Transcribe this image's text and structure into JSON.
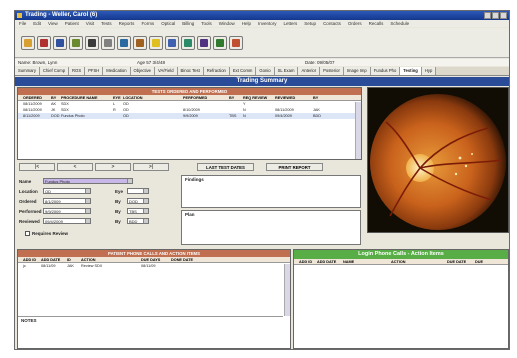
{
  "window": {
    "title": "Trading - Weller, Carol (6)"
  },
  "menu": [
    "File",
    "Edit",
    "View",
    "Patient",
    "Visit",
    "Tests",
    "Reports",
    "Forms",
    "Optical",
    "Billing",
    "Tools",
    "Window",
    "Help",
    "Inventory",
    "Letters",
    "Setup",
    "Contacts",
    "Orders",
    "Recalls",
    "Schedule"
  ],
  "toolbar": [
    "folder",
    "print",
    "person",
    "card",
    "binoculars",
    "glasses",
    "eye",
    "camera",
    "alert",
    "document",
    "grid",
    "network",
    "chart",
    "help"
  ],
  "patient": {
    "name": "Name: Brown, Lynn",
    "age": "Age 57  3/4/48",
    "date": "Date: 09/05/07"
  },
  "tabs": [
    "Summary",
    "Chief Comp",
    "ROS",
    "PFSH",
    "Medication",
    "Objective",
    "VA/Field",
    "Binoc Test",
    "Refraction",
    "Ext Comm",
    "Gonio",
    "SL Exam",
    "Anterior",
    "Posterior",
    "Image Imp",
    "Fundus Pho",
    "Testing",
    "Hyp"
  ],
  "active_tab": "Testing",
  "banner": "Trading Summary",
  "results": {
    "header": "TESTS ORDERED AND PERFORMED",
    "columns": [
      "ORDERED",
      "BY",
      "PROCEDURE NAME",
      "EYE",
      "LOCATION",
      "PERFORMED",
      "BY",
      "REQ REVIEW",
      "REVIEWED",
      "BY"
    ],
    "rows": [
      [
        "08/11/2009",
        "AK",
        "SDX",
        "L",
        "OD",
        "",
        "",
        "Y",
        "",
        ""
      ],
      [
        "08/11/2009",
        "JK",
        "SDX",
        "R",
        "OD",
        "8/10/2009",
        "",
        "N",
        "08/11/2009",
        "JAK"
      ],
      [
        "8/11/2009",
        "DOD",
        "Fundus Photo",
        "",
        "OD",
        "9/9/2009",
        "TBS",
        "N",
        "09/4/2009",
        "BDD"
      ]
    ]
  },
  "nav": {
    "first": "|<",
    "prev": "<",
    "next": ">",
    "last": ">|",
    "last_test_dates": "LAST TEST DATES",
    "print_report": "PRINT REPORT"
  },
  "form": {
    "name_label": "Name",
    "name_value": "Fundus Photo",
    "location_label": "Location",
    "location_value": "OD",
    "eye_label": "Eye",
    "eye_value": "",
    "ordered_label": "Ordered",
    "ordered_value": "8/1/2009",
    "ordered_by_label": "By",
    "ordered_by_value": "DOD",
    "performed_label": "Performed",
    "performed_value": "9/9/2009",
    "performed_by_label": "By",
    "performed_by_value": "TBS",
    "reviewed_label": "Reviewed",
    "reviewed_value": "09/4/2009",
    "reviewed_by_label": "By",
    "reviewed_by_value": "BDD",
    "requires_review": "Requires Review"
  },
  "findings_label": "Findings",
  "plan_label": "Plan",
  "calls_left": {
    "header": "PATIENT PHONE CALLS AND ACTION ITEMS",
    "columns": [
      "ADD ID",
      "ADD DATE",
      "ID",
      "ACTION",
      "DUE DAYS",
      "DONE DATE"
    ],
    "rows": [
      [
        "jc",
        "08/11/09",
        "JAK",
        "Review SDX",
        "08/11/09",
        ""
      ]
    ]
  },
  "calls_right": {
    "header": "Login Phone Calls - Action Items",
    "columns": [
      "ADD ID",
      "ADD DATE",
      "NAME",
      "ACTION",
      "DUE DATE",
      "DUE"
    ]
  },
  "notes_label": "NOTES"
}
